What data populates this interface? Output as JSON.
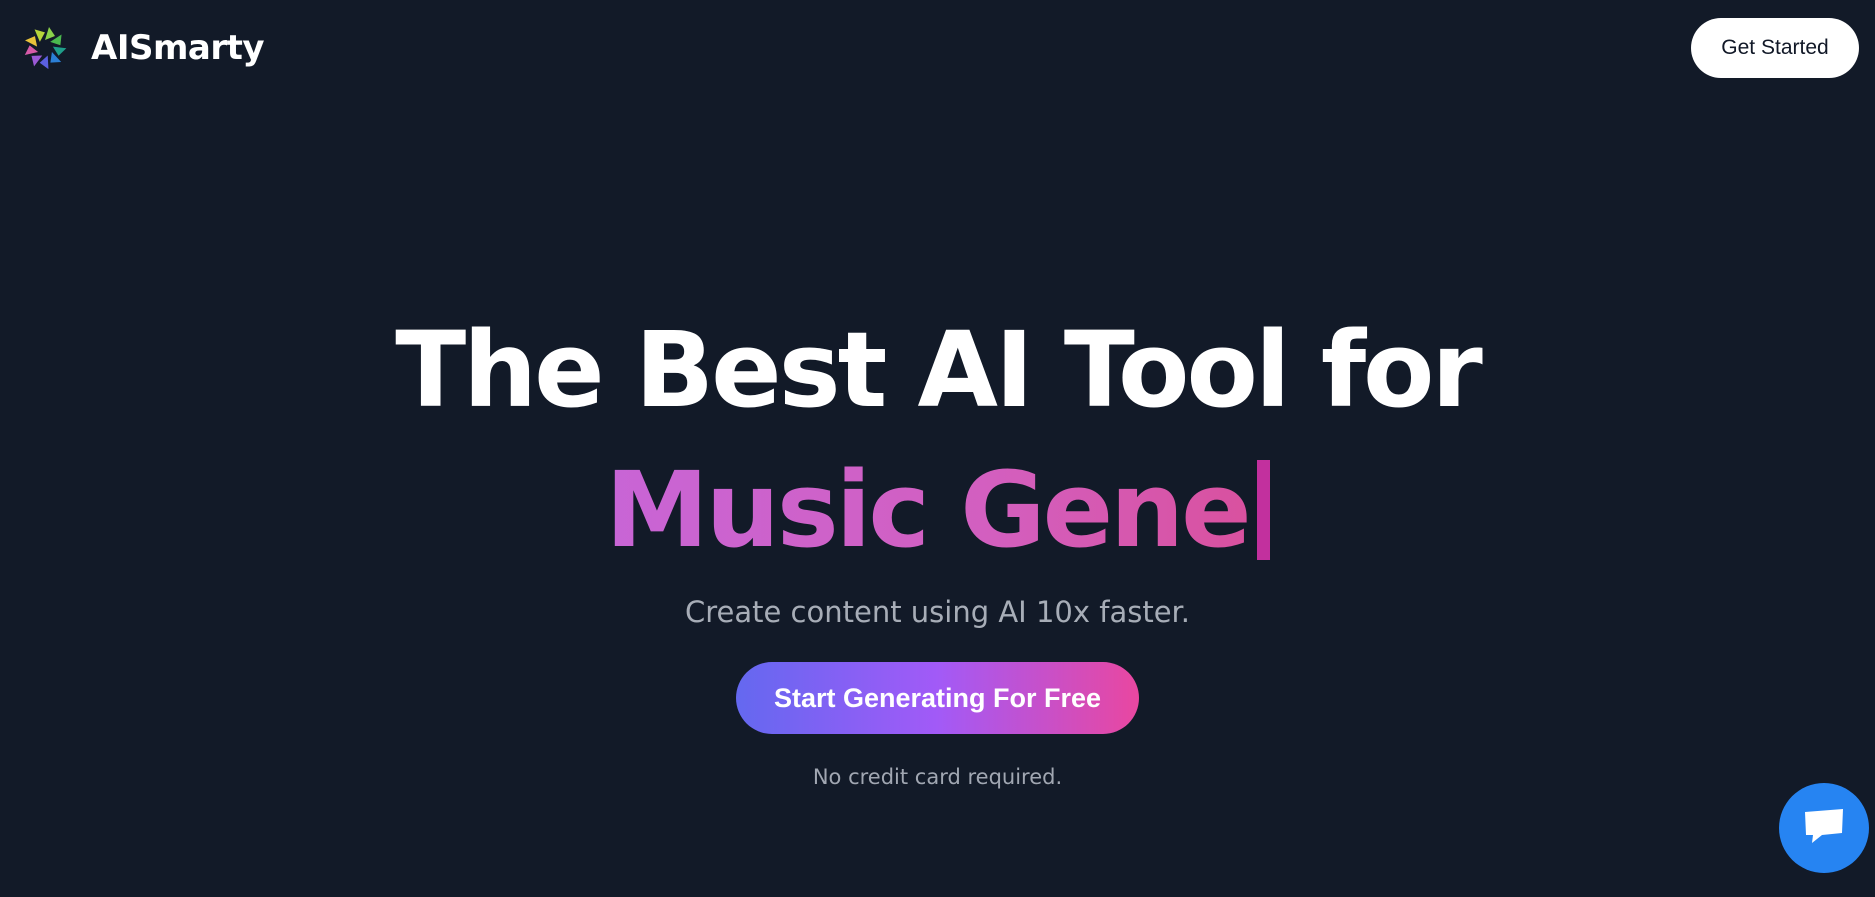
{
  "header": {
    "brand_name": "AISmarty",
    "logo_icon": "swirl-logo-icon",
    "get_started_label": "Get Started"
  },
  "hero": {
    "headline": "The Best AI Tool for",
    "typed_text": "Music Gene",
    "subtitle": "Create content using AI 10x faster.",
    "cta_label": "Start Generating For Free",
    "note": "No credit card required."
  },
  "chat": {
    "icon": "chat-bubble-icon"
  },
  "colors": {
    "background": "#121a28",
    "cta_gradient": [
      "#6468f0",
      "#a25af7",
      "#e947a0"
    ],
    "typed_gradient": [
      "#c865d6",
      "#d9519f"
    ],
    "chat_button": "#2684f2"
  }
}
